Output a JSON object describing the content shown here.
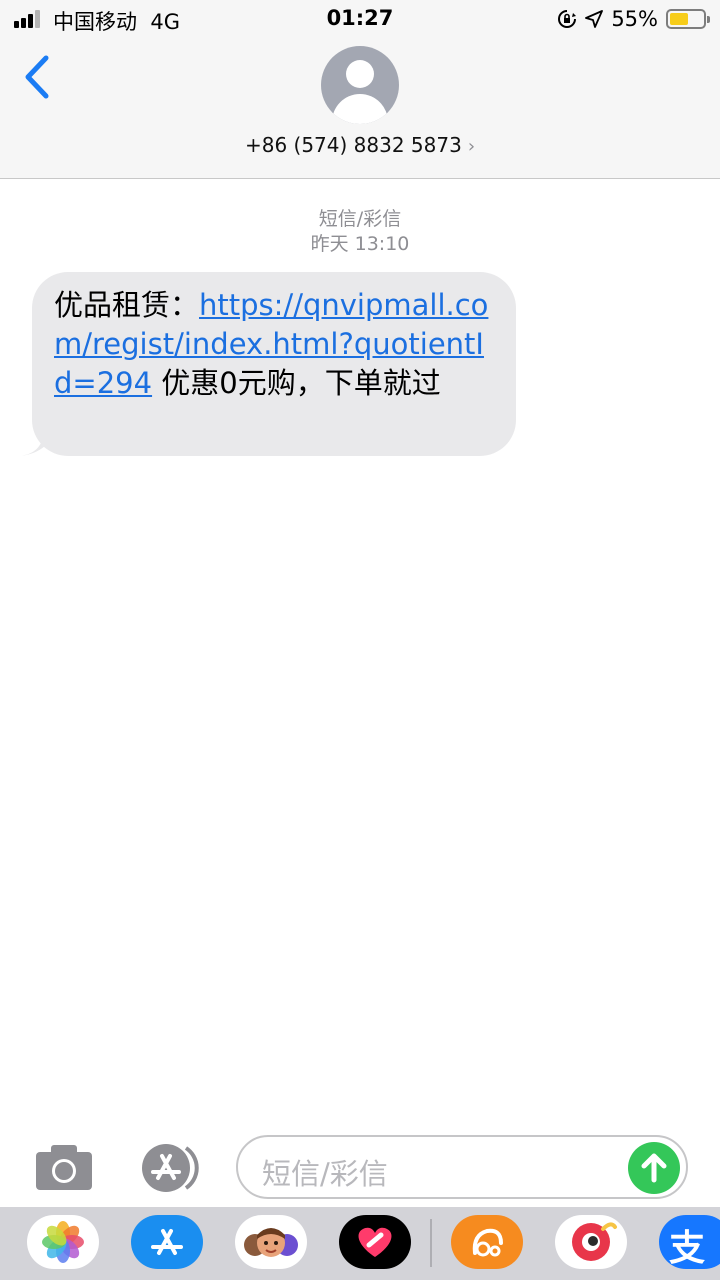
{
  "status_bar": {
    "carrier": "中国移动",
    "network": "4G",
    "time": "01:27",
    "battery_percent": "55%",
    "battery_level": 0.55,
    "battery_color": "#f7cd1a"
  },
  "header": {
    "back_icon": "chevron-left-icon",
    "contact_number": "+86 (574) 8832 5873",
    "chevron_icon": "chevron-right-icon",
    "accent_color": "#1b7cf4"
  },
  "conversation": {
    "message_type": "短信/彩信",
    "timestamp": "昨天 13:10",
    "message": {
      "prefix": "优品租赁：",
      "link": "https://qnvipmall.com/regist/index.html?quotientId=294",
      "suffix": " 优惠0元购，下单就过",
      "bubble_color": "#e9e9eb",
      "link_color": "#1b6fe0"
    }
  },
  "input_bar": {
    "placeholder": "短信/彩信",
    "camera_icon": "camera-icon",
    "appstore_icon": "app-store-icon",
    "send_icon": "arrow-up-icon",
    "send_color": "#34c759"
  },
  "app_drawer": {
    "apps": [
      {
        "name": "photos-icon"
      },
      {
        "name": "app-store-icon"
      },
      {
        "name": "memoji-icon"
      },
      {
        "name": "digital-touch-icon"
      },
      {
        "name": "uc-browser-icon"
      },
      {
        "name": "red-app-icon"
      },
      {
        "name": "alipay-icon",
        "glyph": "支"
      }
    ]
  }
}
